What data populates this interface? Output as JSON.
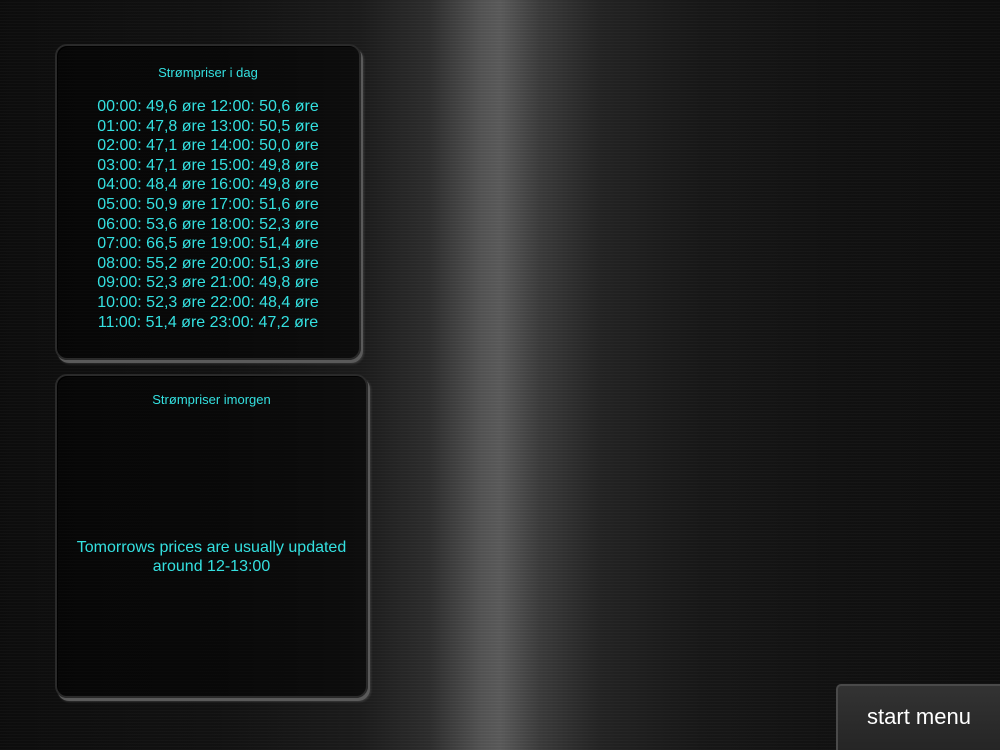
{
  "today": {
    "title": "Strømpriser i dag",
    "prices": [
      "00:00: 49,6 øre 12:00: 50,6 øre",
      "01:00: 47,8 øre 13:00: 50,5 øre",
      "02:00: 47,1 øre 14:00: 50,0 øre",
      "03:00: 47,1 øre 15:00: 49,8 øre",
      "04:00: 48,4 øre 16:00: 49,8 øre",
      "05:00: 50,9 øre 17:00: 51,6 øre",
      "06:00: 53,6 øre 18:00: 52,3 øre",
      "07:00: 66,5 øre 19:00: 51,4 øre",
      "08:00: 55,2 øre 20:00: 51,3 øre",
      "09:00: 52,3 øre 21:00: 49,8 øre",
      "10:00: 52,3 øre 22:00: 48,4 øre",
      "11:00: 51,4 øre 23:00: 47,2 øre"
    ]
  },
  "tomorrow": {
    "title": "Strømpriser imorgen",
    "notice_line1": "Tomorrows prices are usually updated",
    "notice_line2": "around 12-13:00"
  },
  "start_menu": {
    "label": "start menu"
  },
  "colors": {
    "accent": "#34e0e0",
    "background": "#0c0c0c",
    "button_text": "#ffffff"
  }
}
